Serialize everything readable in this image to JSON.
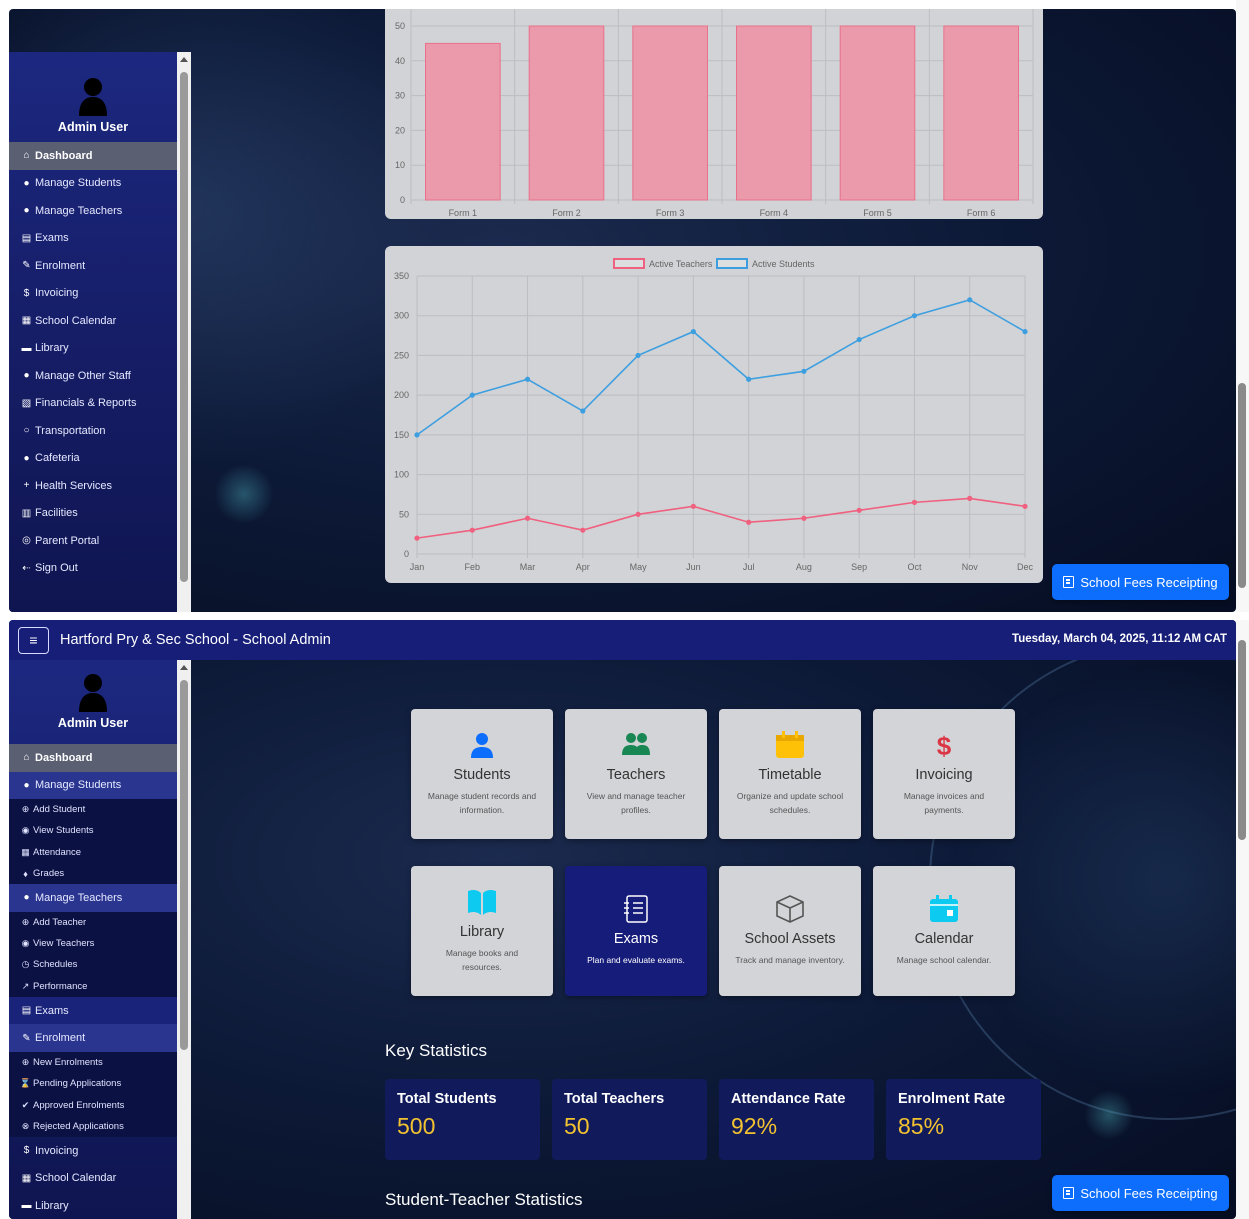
{
  "app": {
    "title": "Hartford Pry & Sec School - School Admin",
    "datetime": "Tuesday, March 04, 2025, 11:12 AM CAT",
    "menu_icon": "hamburger-icon"
  },
  "user": {
    "name": "Admin User",
    "icon": "user-silhouette-icon"
  },
  "sidebar_top": {
    "items": [
      {
        "label": "Dashboard",
        "icon": "home-icon",
        "active": true
      },
      {
        "label": "Manage Students",
        "icon": "person-icon"
      },
      {
        "label": "Manage Teachers",
        "icon": "people-icon"
      },
      {
        "label": "Exams",
        "icon": "clipboard-icon"
      },
      {
        "label": "Enrolment",
        "icon": "edit-icon"
      },
      {
        "label": "Invoicing",
        "icon": "dollar-icon"
      },
      {
        "label": "School Calendar",
        "icon": "calendar-icon"
      },
      {
        "label": "Library",
        "icon": "book-icon"
      },
      {
        "label": "Manage Other Staff",
        "icon": "people-icon"
      },
      {
        "label": "Financials & Reports",
        "icon": "money-report-icon"
      },
      {
        "label": "Transportation",
        "icon": "circle-icon"
      },
      {
        "label": "Cafeteria",
        "icon": "cafeteria-icon"
      },
      {
        "label": "Health Services",
        "icon": "plus-icon"
      },
      {
        "label": "Facilities",
        "icon": "building-icon"
      },
      {
        "label": "Parent Portal",
        "icon": "user-circle-icon"
      },
      {
        "label": "Sign Out",
        "icon": "sign-out-icon"
      }
    ]
  },
  "sidebar_bottom": {
    "dashboard": "Dashboard",
    "manage_students": "Manage Students",
    "students_sub": [
      "Add Student",
      "View Students",
      "Attendance",
      "Grades"
    ],
    "manage_teachers": "Manage Teachers",
    "teachers_sub": [
      "Add Teacher",
      "View Teachers",
      "Schedules",
      "Performance"
    ],
    "exams": "Exams",
    "enrolment": "Enrolment",
    "enrolment_sub": [
      "New Enrolments",
      "Pending Applications",
      "Approved Enrolments",
      "Rejected Applications"
    ],
    "invoicing": "Invoicing",
    "school_calendar": "School Calendar",
    "library": "Library"
  },
  "fees_button": {
    "label": "School Fees Receipting",
    "icon": "receipt-icon"
  },
  "tiles": [
    {
      "title": "Students",
      "desc": "Manage student records and information.",
      "icon": "person-icon",
      "color": "#0d6efd"
    },
    {
      "title": "Teachers",
      "desc": "View and manage teacher profiles.",
      "icon": "people-icon",
      "color": "#198754"
    },
    {
      "title": "Timetable",
      "desc": "Organize and update school schedules.",
      "icon": "calendar-blank-icon",
      "color": "#ffc107"
    },
    {
      "title": "Invoicing",
      "desc": "Manage invoices and payments.",
      "icon": "dollar-icon",
      "color": "#dc3545"
    },
    {
      "title": "Library",
      "desc": "Manage books and resources.",
      "icon": "open-book-icon",
      "color": "#0dcaf0"
    },
    {
      "title": "Exams",
      "desc": "Plan and evaluate exams.",
      "icon": "exam-list-icon",
      "color": "#ffffff",
      "highlighted": true
    },
    {
      "title": "School Assets",
      "desc": "Track and manage inventory.",
      "icon": "box-icon",
      "color": "#555555"
    },
    {
      "title": "Calendar",
      "desc": "Manage school calendar.",
      "icon": "calendar-event-icon",
      "color": "#0dcaf0"
    }
  ],
  "key_statistics": {
    "title": "Key Statistics",
    "items": [
      {
        "label": "Total Students",
        "value": "500"
      },
      {
        "label": "Total Teachers",
        "value": "50"
      },
      {
        "label": "Attendance Rate",
        "value": "92%"
      },
      {
        "label": "Enrolment Rate",
        "value": "85%"
      }
    ]
  },
  "student_teacher_title": "Student-Teacher Statistics",
  "chart_data": [
    {
      "type": "bar",
      "categories": [
        "Form 1",
        "Form 2",
        "Form 3",
        "Form 4",
        "Form 5",
        "Form 6"
      ],
      "values": [
        45,
        55,
        53,
        50,
        55,
        55
      ],
      "yticks": [
        0,
        10,
        20,
        30,
        40,
        50
      ],
      "ylim": [
        0,
        50
      ],
      "bar_color": "#eb9aab",
      "bar_border": "#e8708b",
      "grid": true
    },
    {
      "type": "line",
      "categories": [
        "Jan",
        "Feb",
        "Mar",
        "Apr",
        "May",
        "Jun",
        "Jul",
        "Aug",
        "Sep",
        "Oct",
        "Nov",
        "Dec"
      ],
      "series": [
        {
          "name": "Active Teachers",
          "values": [
            20,
            30,
            45,
            30,
            50,
            60,
            40,
            45,
            55,
            65,
            70,
            60
          ],
          "color": "#f0607f"
        },
        {
          "name": "Active Students",
          "values": [
            150,
            200,
            220,
            180,
            250,
            280,
            220,
            230,
            270,
            300,
            320,
            280
          ],
          "color": "#3e9fe0"
        }
      ],
      "yticks": [
        0,
        50,
        100,
        150,
        200,
        250,
        300,
        350
      ],
      "ylim": [
        0,
        350
      ],
      "legend": "top",
      "grid": true
    }
  ]
}
